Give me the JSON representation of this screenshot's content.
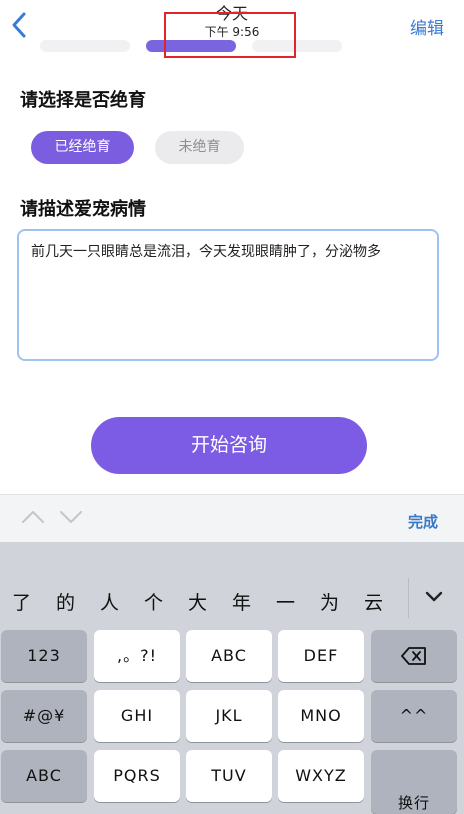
{
  "nav": {
    "back_icon": "chevron-left-icon",
    "title": "今天",
    "subtitle": "下午 9:56",
    "edit_label": "编辑"
  },
  "colors": {
    "accent_purple": "#7b5ee0",
    "link_blue": "#3a7bd5",
    "highlight_red": "#e0242a",
    "focus_border": "#9ec3f2"
  },
  "neuter": {
    "question": "请选择是否绝育",
    "options": [
      {
        "label": "已经绝育",
        "selected": true
      },
      {
        "label": "未绝育",
        "selected": false
      }
    ]
  },
  "description": {
    "question": "请描述爱宠病情",
    "value": "前几天一只眼睛总是流泪，今天发现眼睛肿了，分泌物多"
  },
  "start_button_label": "开始咨询",
  "accessory": {
    "up_icon": "chevron-up-icon",
    "down_icon": "chevron-down-icon",
    "done_label": "完成"
  },
  "keyboard": {
    "candidates": [
      "了",
      "的",
      "人",
      "个",
      "大",
      "年",
      "一",
      "为",
      "云"
    ],
    "expand_icon": "chevron-down-icon",
    "row1": [
      "123",
      ",。?!",
      "ABC",
      "DEF",
      "delete-icon"
    ],
    "row2": [
      "#@¥",
      "GHI",
      "JKL",
      "MNO",
      "^^"
    ],
    "row3": [
      "ABC",
      "PQRS",
      "TUV",
      "WXYZ",
      "换行"
    ]
  }
}
